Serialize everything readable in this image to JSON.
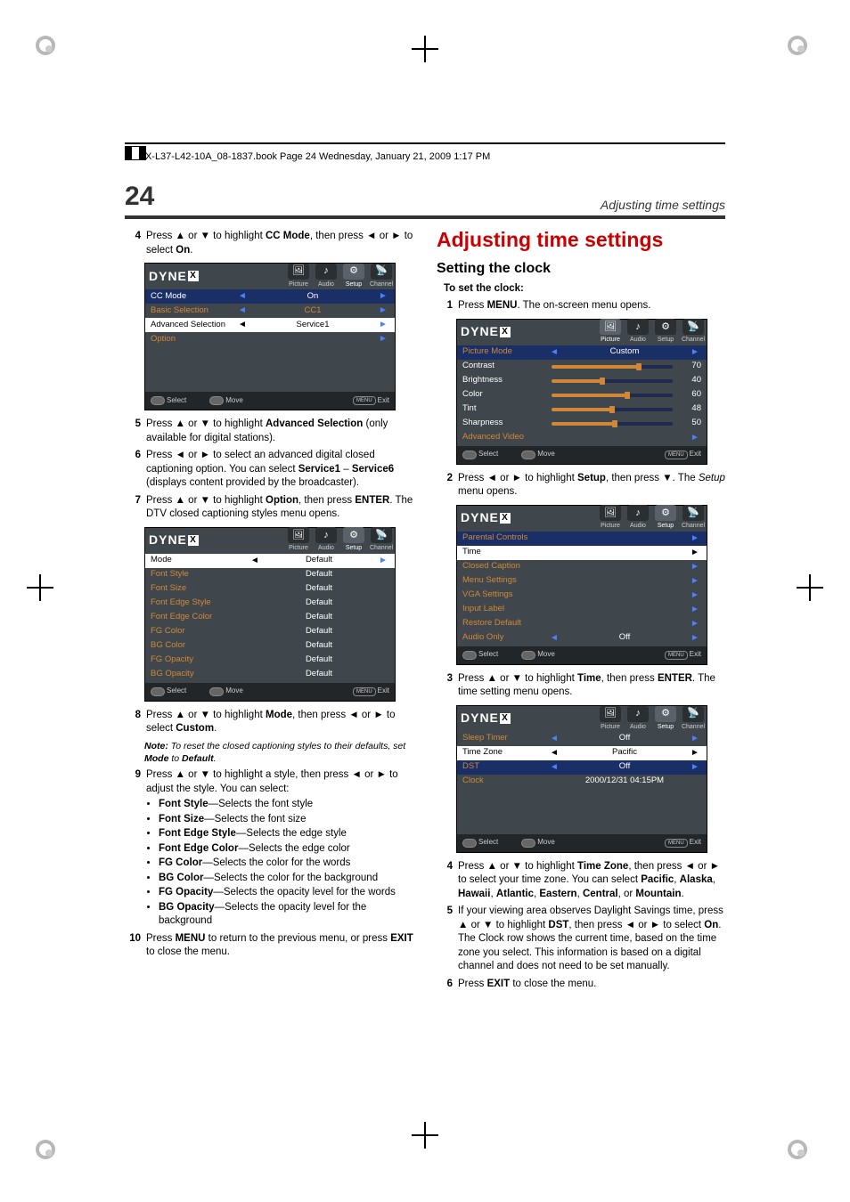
{
  "header_line": "DX-L37-L42-10A_08-1837.book  Page 24  Wednesday, January 21, 2009  1:17 PM",
  "page_number": "24",
  "page_heading": "Adjusting time settings",
  "left": {
    "step4": "Press ▲ or ▼ to highlight CC Mode, then press ◄ or ► to select On.",
    "step5": "Press ▲ or ▼ to highlight Advanced Selection (only available for digital stations).",
    "step6": "Press ◄ or ► to select an advanced digital closed captioning option. You can select Service1 – Service6 (displays content provided by the broadcaster).",
    "step7": "Press ▲ or ▼ to highlight Option, then press ENTER. The DTV closed captioning styles menu opens.",
    "step8": "Press ▲ or ▼ to highlight Mode, then press ◄ or ► to select Custom.",
    "note_prefix": "Note:",
    "note_body": " To reset the closed captioning styles to their defaults, set Mode to Default.",
    "step9": "Press ▲ or ▼ to highlight a style, then press ◄ or ► to adjust the style. You can select:",
    "bullets": [
      {
        "k": "Font Style",
        "v": "—Selects the font style"
      },
      {
        "k": "Font Size",
        "v": "—Selects the font size"
      },
      {
        "k": "Font Edge Style",
        "v": "—Selects the edge style"
      },
      {
        "k": "Font Edge Color",
        "v": "—Selects the edge color"
      },
      {
        "k": "FG Color",
        "v": "—Selects the color for the words"
      },
      {
        "k": "BG Color",
        "v": "—Selects the color for the background"
      },
      {
        "k": "FG Opacity",
        "v": "—Selects the opacity level for the words"
      },
      {
        "k": "BG Opacity",
        "v": "—Selects the opacity level for the background"
      }
    ],
    "step10": "Press MENU to return to the previous menu, or press EXIT to close the menu."
  },
  "right": {
    "h1": "Adjusting time settings",
    "h2": "Setting the clock",
    "h3": "To set the clock:",
    "step1": "Press MENU. The on-screen menu opens.",
    "step2": "Press ◄ or ► to highlight Setup, then press ▼. The Setup menu opens.",
    "step3": "Press ▲ or ▼ to highlight Time, then press ENTER. The time setting menu opens.",
    "step4": "Press ▲ or ▼ to highlight Time Zone, then press ◄ or ► to select your time zone. You can select Pacific, Alaska, Hawaii, Atlantic, Eastern, Central, or Mountain.",
    "step5a": "If your viewing area observes Daylight Savings time, press ▲ or ▼ to highlight DST, then press ◄ or ► to select On.",
    "step5b": "The Clock row shows the current time, based on the time zone you select. This information is based on a digital channel and does not need to be set manually.",
    "step6": "Press EXIT to close the menu."
  },
  "osd": {
    "logo": "DYNE",
    "logo_x": "X",
    "tabs": [
      "Picture",
      "Audio",
      "Setup",
      "Channel"
    ],
    "footer": {
      "select": "Select",
      "move": "Move",
      "menu": "MENU",
      "exit": "Exit"
    },
    "cc": {
      "rows": [
        {
          "label": "CC Mode",
          "val": "On",
          "la": "◄",
          "ra": "►"
        },
        {
          "label": "Basic Selection",
          "val": "CC1",
          "la": "◄",
          "ra": "►",
          "orange": true
        },
        {
          "label": "Advanced Selection",
          "val": "Service1",
          "la": "◄",
          "ra": "►",
          "white": true
        },
        {
          "label": "Option",
          "val": "",
          "la": "",
          "ra": "►",
          "orange": true
        }
      ]
    },
    "styles": {
      "rows": [
        {
          "label": "Mode",
          "val": "Default",
          "la": "◄",
          "ra": "►",
          "white": true
        },
        {
          "label": "Font Style",
          "val": "Default"
        },
        {
          "label": "Font Size",
          "val": "Default"
        },
        {
          "label": "Font Edge Style",
          "val": "Default"
        },
        {
          "label": "Font Edge Color",
          "val": "Default"
        },
        {
          "label": "FG Color",
          "val": "Default"
        },
        {
          "label": "BG Color",
          "val": "Default"
        },
        {
          "label": "FG Opacity",
          "val": "Default"
        },
        {
          "label": "BG Opacity",
          "val": "Default"
        }
      ]
    },
    "picture": {
      "mode": {
        "label": "Picture Mode",
        "val": "Custom"
      },
      "sliders": [
        {
          "label": "Contrast",
          "val": "70"
        },
        {
          "label": "Brightness",
          "val": "40"
        },
        {
          "label": "Color",
          "val": "60"
        },
        {
          "label": "Tint",
          "val": "48"
        },
        {
          "label": "Sharpness",
          "val": "50"
        }
      ],
      "advanced": "Advanced Video"
    },
    "setup": {
      "rows": [
        {
          "label": "Parental Controls",
          "ra": "►",
          "orange": true
        },
        {
          "label": "Time",
          "ra": "►",
          "white": true
        },
        {
          "label": "Closed Caption",
          "ra": "►",
          "orange": true
        },
        {
          "label": "Menu Settings",
          "ra": "►",
          "orange": true
        },
        {
          "label": "VGA Settings",
          "ra": "►",
          "orange": true
        },
        {
          "label": "Input Label",
          "ra": "►",
          "orange": true
        },
        {
          "label": "Restore Default",
          "ra": "►",
          "orange": true
        },
        {
          "label": "Audio Only",
          "val": "Off",
          "la": "◄",
          "ra": "►",
          "orange": true
        }
      ]
    },
    "time": {
      "rows": [
        {
          "label": "Sleep Timer",
          "val": "Off",
          "la": "◄",
          "ra": "►",
          "orange": true
        },
        {
          "label": "Time Zone",
          "val": "Pacific",
          "la": "◄",
          "ra": "►",
          "white": true
        },
        {
          "label": "DST",
          "val": "Off",
          "la": "◄",
          "ra": "►",
          "orange": true,
          "header": true
        },
        {
          "label": "Clock",
          "val": "2000/12/31 04:15PM",
          "orange": true
        }
      ]
    }
  }
}
